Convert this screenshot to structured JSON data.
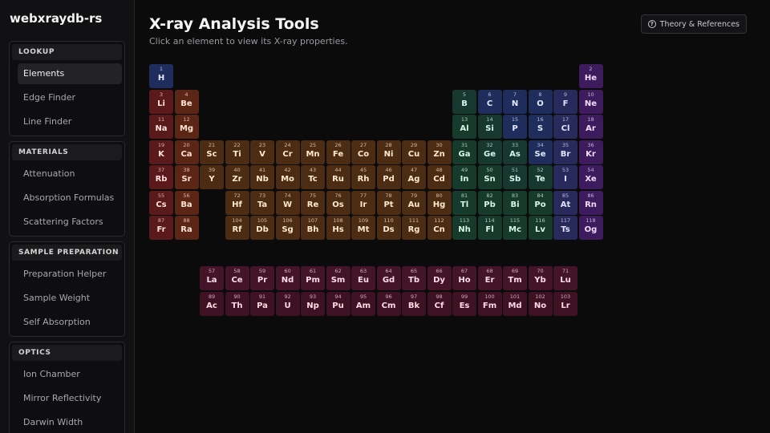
{
  "sidebar": {
    "app_title": "webxraydb-rs",
    "sections": [
      {
        "header": "LOOKUP",
        "items": [
          "Elements",
          "Edge Finder",
          "Line Finder"
        ]
      },
      {
        "header": "MATERIALS",
        "items": [
          "Attenuation",
          "Absorption Formulas",
          "Scattering Factors"
        ]
      },
      {
        "header": "SAMPLE PREPARATION",
        "items": [
          "Preparation Helper",
          "Sample Weight",
          "Self Absorption"
        ]
      },
      {
        "header": "OPTICS",
        "items": [
          "Ion Chamber",
          "Mirror Reflectivity",
          "Darwin Width"
        ]
      }
    ],
    "active_item": "Elements"
  },
  "main": {
    "title": "X-ray Analysis Tools",
    "subtitle": "Click an element to view its X-ray properties.",
    "theory_button": "Theory & References"
  },
  "icons": {
    "theory": "question-circle-icon"
  },
  "categories": {
    "nonmetal": {
      "bg": "#1e2d5c",
      "text": "#e4e9ff"
    },
    "noble": {
      "bg": "#3e1b5c",
      "text": "#eedcff"
    },
    "alkali": {
      "bg": "#5a1a1c",
      "text": "#ffe0dc"
    },
    "alkaline": {
      "bg": "#5c2616",
      "text": "#ffe3d3"
    },
    "transition": {
      "bg": "#4c2c13",
      "text": "#ffe9cf"
    },
    "post": {
      "bg": "#163a2c",
      "text": "#d9f7e6"
    },
    "metalloid": {
      "bg": "#17382f",
      "text": "#d7f5ea"
    },
    "halogen": {
      "bg": "#292a5c",
      "text": "#e2e2ff"
    },
    "lanthanide": {
      "bg": "#441428",
      "text": "#ffdcea"
    },
    "actinide": {
      "bg": "#3f1223",
      "text": "#ffd9e6"
    }
  },
  "elements": [
    {
      "n": 1,
      "s": "H",
      "c": "nonmetal",
      "g": 1,
      "p": 1
    },
    {
      "n": 2,
      "s": "He",
      "c": "noble",
      "g": 18,
      "p": 1
    },
    {
      "n": 3,
      "s": "Li",
      "c": "alkali",
      "g": 1,
      "p": 2
    },
    {
      "n": 4,
      "s": "Be",
      "c": "alkaline",
      "g": 2,
      "p": 2
    },
    {
      "n": 5,
      "s": "B",
      "c": "metalloid",
      "g": 13,
      "p": 2
    },
    {
      "n": 6,
      "s": "C",
      "c": "nonmetal",
      "g": 14,
      "p": 2
    },
    {
      "n": 7,
      "s": "N",
      "c": "nonmetal",
      "g": 15,
      "p": 2
    },
    {
      "n": 8,
      "s": "O",
      "c": "nonmetal",
      "g": 16,
      "p": 2
    },
    {
      "n": 9,
      "s": "F",
      "c": "halogen",
      "g": 17,
      "p": 2
    },
    {
      "n": 10,
      "s": "Ne",
      "c": "noble",
      "g": 18,
      "p": 2
    },
    {
      "n": 11,
      "s": "Na",
      "c": "alkali",
      "g": 1,
      "p": 3
    },
    {
      "n": 12,
      "s": "Mg",
      "c": "alkaline",
      "g": 2,
      "p": 3
    },
    {
      "n": 13,
      "s": "Al",
      "c": "post",
      "g": 13,
      "p": 3
    },
    {
      "n": 14,
      "s": "Si",
      "c": "metalloid",
      "g": 14,
      "p": 3
    },
    {
      "n": 15,
      "s": "P",
      "c": "nonmetal",
      "g": 15,
      "p": 3
    },
    {
      "n": 16,
      "s": "S",
      "c": "nonmetal",
      "g": 16,
      "p": 3
    },
    {
      "n": 17,
      "s": "Cl",
      "c": "halogen",
      "g": 17,
      "p": 3
    },
    {
      "n": 18,
      "s": "Ar",
      "c": "noble",
      "g": 18,
      "p": 3
    },
    {
      "n": 19,
      "s": "K",
      "c": "alkali",
      "g": 1,
      "p": 4
    },
    {
      "n": 20,
      "s": "Ca",
      "c": "alkaline",
      "g": 2,
      "p": 4
    },
    {
      "n": 21,
      "s": "Sc",
      "c": "transition",
      "g": 3,
      "p": 4
    },
    {
      "n": 22,
      "s": "Ti",
      "c": "transition",
      "g": 4,
      "p": 4
    },
    {
      "n": 23,
      "s": "V",
      "c": "transition",
      "g": 5,
      "p": 4
    },
    {
      "n": 24,
      "s": "Cr",
      "c": "transition",
      "g": 6,
      "p": 4
    },
    {
      "n": 25,
      "s": "Mn",
      "c": "transition",
      "g": 7,
      "p": 4
    },
    {
      "n": 26,
      "s": "Fe",
      "c": "transition",
      "g": 8,
      "p": 4
    },
    {
      "n": 27,
      "s": "Co",
      "c": "transition",
      "g": 9,
      "p": 4
    },
    {
      "n": 28,
      "s": "Ni",
      "c": "transition",
      "g": 10,
      "p": 4
    },
    {
      "n": 29,
      "s": "Cu",
      "c": "transition",
      "g": 11,
      "p": 4
    },
    {
      "n": 30,
      "s": "Zn",
      "c": "transition",
      "g": 12,
      "p": 4
    },
    {
      "n": 31,
      "s": "Ga",
      "c": "post",
      "g": 13,
      "p": 4
    },
    {
      "n": 32,
      "s": "Ge",
      "c": "metalloid",
      "g": 14,
      "p": 4
    },
    {
      "n": 33,
      "s": "As",
      "c": "metalloid",
      "g": 15,
      "p": 4
    },
    {
      "n": 34,
      "s": "Se",
      "c": "nonmetal",
      "g": 16,
      "p": 4
    },
    {
      "n": 35,
      "s": "Br",
      "c": "halogen",
      "g": 17,
      "p": 4
    },
    {
      "n": 36,
      "s": "Kr",
      "c": "noble",
      "g": 18,
      "p": 4
    },
    {
      "n": 37,
      "s": "Rb",
      "c": "alkali",
      "g": 1,
      "p": 5
    },
    {
      "n": 38,
      "s": "Sr",
      "c": "alkaline",
      "g": 2,
      "p": 5
    },
    {
      "n": 39,
      "s": "Y",
      "c": "transition",
      "g": 3,
      "p": 5
    },
    {
      "n": 40,
      "s": "Zr",
      "c": "transition",
      "g": 4,
      "p": 5
    },
    {
      "n": 41,
      "s": "Nb",
      "c": "transition",
      "g": 5,
      "p": 5
    },
    {
      "n": 42,
      "s": "Mo",
      "c": "transition",
      "g": 6,
      "p": 5
    },
    {
      "n": 43,
      "s": "Tc",
      "c": "transition",
      "g": 7,
      "p": 5
    },
    {
      "n": 44,
      "s": "Ru",
      "c": "transition",
      "g": 8,
      "p": 5
    },
    {
      "n": 45,
      "s": "Rh",
      "c": "transition",
      "g": 9,
      "p": 5
    },
    {
      "n": 46,
      "s": "Pd",
      "c": "transition",
      "g": 10,
      "p": 5
    },
    {
      "n": 47,
      "s": "Ag",
      "c": "transition",
      "g": 11,
      "p": 5
    },
    {
      "n": 48,
      "s": "Cd",
      "c": "transition",
      "g": 12,
      "p": 5
    },
    {
      "n": 49,
      "s": "In",
      "c": "post",
      "g": 13,
      "p": 5
    },
    {
      "n": 50,
      "s": "Sn",
      "c": "post",
      "g": 14,
      "p": 5
    },
    {
      "n": 51,
      "s": "Sb",
      "c": "metalloid",
      "g": 15,
      "p": 5
    },
    {
      "n": 52,
      "s": "Te",
      "c": "metalloid",
      "g": 16,
      "p": 5
    },
    {
      "n": 53,
      "s": "I",
      "c": "halogen",
      "g": 17,
      "p": 5
    },
    {
      "n": 54,
      "s": "Xe",
      "c": "noble",
      "g": 18,
      "p": 5
    },
    {
      "n": 55,
      "s": "Cs",
      "c": "alkali",
      "g": 1,
      "p": 6
    },
    {
      "n": 56,
      "s": "Ba",
      "c": "alkaline",
      "g": 2,
      "p": 6
    },
    {
      "n": 72,
      "s": "Hf",
      "c": "transition",
      "g": 4,
      "p": 6
    },
    {
      "n": 73,
      "s": "Ta",
      "c": "transition",
      "g": 5,
      "p": 6
    },
    {
      "n": 74,
      "s": "W",
      "c": "transition",
      "g": 6,
      "p": 6
    },
    {
      "n": 75,
      "s": "Re",
      "c": "transition",
      "g": 7,
      "p": 6
    },
    {
      "n": 76,
      "s": "Os",
      "c": "transition",
      "g": 8,
      "p": 6
    },
    {
      "n": 77,
      "s": "Ir",
      "c": "transition",
      "g": 9,
      "p": 6
    },
    {
      "n": 78,
      "s": "Pt",
      "c": "transition",
      "g": 10,
      "p": 6
    },
    {
      "n": 79,
      "s": "Au",
      "c": "transition",
      "g": 11,
      "p": 6
    },
    {
      "n": 80,
      "s": "Hg",
      "c": "transition",
      "g": 12,
      "p": 6
    },
    {
      "n": 81,
      "s": "Tl",
      "c": "post",
      "g": 13,
      "p": 6
    },
    {
      "n": 82,
      "s": "Pb",
      "c": "post",
      "g": 14,
      "p": 6
    },
    {
      "n": 83,
      "s": "Bi",
      "c": "post",
      "g": 15,
      "p": 6
    },
    {
      "n": 84,
      "s": "Po",
      "c": "post",
      "g": 16,
      "p": 6
    },
    {
      "n": 85,
      "s": "At",
      "c": "halogen",
      "g": 17,
      "p": 6
    },
    {
      "n": 86,
      "s": "Rn",
      "c": "noble",
      "g": 18,
      "p": 6
    },
    {
      "n": 87,
      "s": "Fr",
      "c": "alkali",
      "g": 1,
      "p": 7
    },
    {
      "n": 88,
      "s": "Ra",
      "c": "alkaline",
      "g": 2,
      "p": 7
    },
    {
      "n": 104,
      "s": "Rf",
      "c": "transition",
      "g": 4,
      "p": 7
    },
    {
      "n": 105,
      "s": "Db",
      "c": "transition",
      "g": 5,
      "p": 7
    },
    {
      "n": 106,
      "s": "Sg",
      "c": "transition",
      "g": 6,
      "p": 7
    },
    {
      "n": 107,
      "s": "Bh",
      "c": "transition",
      "g": 7,
      "p": 7
    },
    {
      "n": 108,
      "s": "Hs",
      "c": "transition",
      "g": 8,
      "p": 7
    },
    {
      "n": 109,
      "s": "Mt",
      "c": "transition",
      "g": 9,
      "p": 7
    },
    {
      "n": 110,
      "s": "Ds",
      "c": "transition",
      "g": 10,
      "p": 7
    },
    {
      "n": 111,
      "s": "Rg",
      "c": "transition",
      "g": 11,
      "p": 7
    },
    {
      "n": 112,
      "s": "Cn",
      "c": "transition",
      "g": 12,
      "p": 7
    },
    {
      "n": 113,
      "s": "Nh",
      "c": "post",
      "g": 13,
      "p": 7
    },
    {
      "n": 114,
      "s": "Fl",
      "c": "post",
      "g": 14,
      "p": 7
    },
    {
      "n": 115,
      "s": "Mc",
      "c": "post",
      "g": 15,
      "p": 7
    },
    {
      "n": 116,
      "s": "Lv",
      "c": "post",
      "g": 16,
      "p": 7
    },
    {
      "n": 117,
      "s": "Ts",
      "c": "halogen",
      "g": 17,
      "p": 7
    },
    {
      "n": 118,
      "s": "Og",
      "c": "noble",
      "g": 18,
      "p": 7
    },
    {
      "n": 57,
      "s": "La",
      "c": "lanthanide",
      "g": 3,
      "p": 9
    },
    {
      "n": 58,
      "s": "Ce",
      "c": "lanthanide",
      "g": 4,
      "p": 9
    },
    {
      "n": 59,
      "s": "Pr",
      "c": "lanthanide",
      "g": 5,
      "p": 9
    },
    {
      "n": 60,
      "s": "Nd",
      "c": "lanthanide",
      "g": 6,
      "p": 9
    },
    {
      "n": 61,
      "s": "Pm",
      "c": "lanthanide",
      "g": 7,
      "p": 9
    },
    {
      "n": 62,
      "s": "Sm",
      "c": "lanthanide",
      "g": 8,
      "p": 9
    },
    {
      "n": 63,
      "s": "Eu",
      "c": "lanthanide",
      "g": 9,
      "p": 9
    },
    {
      "n": 64,
      "s": "Gd",
      "c": "lanthanide",
      "g": 10,
      "p": 9
    },
    {
      "n": 65,
      "s": "Tb",
      "c": "lanthanide",
      "g": 11,
      "p": 9
    },
    {
      "n": 66,
      "s": "Dy",
      "c": "lanthanide",
      "g": 12,
      "p": 9
    },
    {
      "n": 67,
      "s": "Ho",
      "c": "lanthanide",
      "g": 13,
      "p": 9
    },
    {
      "n": 68,
      "s": "Er",
      "c": "lanthanide",
      "g": 14,
      "p": 9
    },
    {
      "n": 69,
      "s": "Tm",
      "c": "lanthanide",
      "g": 15,
      "p": 9
    },
    {
      "n": 70,
      "s": "Yb",
      "c": "lanthanide",
      "g": 16,
      "p": 9
    },
    {
      "n": 71,
      "s": "Lu",
      "c": "lanthanide",
      "g": 17,
      "p": 9
    },
    {
      "n": 89,
      "s": "Ac",
      "c": "actinide",
      "g": 3,
      "p": 10
    },
    {
      "n": 90,
      "s": "Th",
      "c": "actinide",
      "g": 4,
      "p": 10
    },
    {
      "n": 91,
      "s": "Pa",
      "c": "actinide",
      "g": 5,
      "p": 10
    },
    {
      "n": 92,
      "s": "U",
      "c": "actinide",
      "g": 6,
      "p": 10
    },
    {
      "n": 93,
      "s": "Np",
      "c": "actinide",
      "g": 7,
      "p": 10
    },
    {
      "n": 94,
      "s": "Pu",
      "c": "actinide",
      "g": 8,
      "p": 10
    },
    {
      "n": 95,
      "s": "Am",
      "c": "actinide",
      "g": 9,
      "p": 10
    },
    {
      "n": 96,
      "s": "Cm",
      "c": "actinide",
      "g": 10,
      "p": 10
    },
    {
      "n": 97,
      "s": "Bk",
      "c": "actinide",
      "g": 11,
      "p": 10
    },
    {
      "n": 98,
      "s": "Cf",
      "c": "actinide",
      "g": 12,
      "p": 10
    },
    {
      "n": 99,
      "s": "Es",
      "c": "actinide",
      "g": 13,
      "p": 10
    },
    {
      "n": 100,
      "s": "Fm",
      "c": "actinide",
      "g": 14,
      "p": 10
    },
    {
      "n": 101,
      "s": "Md",
      "c": "actinide",
      "g": 15,
      "p": 10
    },
    {
      "n": 102,
      "s": "No",
      "c": "actinide",
      "g": 16,
      "p": 10
    },
    {
      "n": 103,
      "s": "Lr",
      "c": "actinide",
      "g": 17,
      "p": 10
    }
  ]
}
